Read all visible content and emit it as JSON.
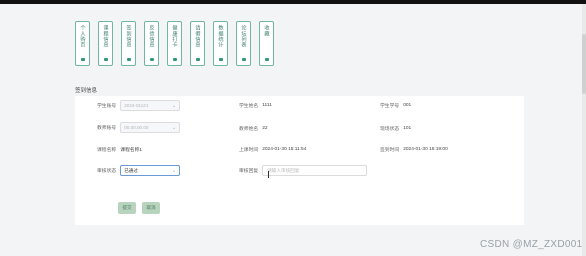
{
  "nav": [
    {
      "label": "个人购页"
    },
    {
      "label": "课程信息"
    },
    {
      "label": "签到信息"
    },
    {
      "label": "反债信息"
    },
    {
      "label": "健康打卡"
    },
    {
      "label": "请假信息"
    },
    {
      "label": "数据统计"
    },
    {
      "label": "论坛列表"
    },
    {
      "label": "收藏"
    }
  ],
  "section_title": "签到信息",
  "form": {
    "student_id_label": "学生账号",
    "student_id_value": "2024-01121",
    "student_name_label": "学生姓名",
    "student_name_value": "1111",
    "student_no_label": "学生学号",
    "student_no_value": "001",
    "teacher_id_label": "教师账号",
    "teacher_id_value": "00.00.00.00",
    "teacher_name_label": "教师姓名",
    "teacher_name_value": "22",
    "status_label": "现场状态",
    "status_value": "101",
    "course_label": "课程名称",
    "course_value": "课程名称1",
    "class_time_label": "上课时间",
    "class_time_value": "2024-01-30 15:11:54",
    "checkin_time_label": "签到时间",
    "checkin_time_value": "2024-01-30 16:19:00",
    "audit_status_label": "审核状态",
    "audit_status_value": "已通过",
    "audit_reply_label": "审核回复",
    "audit_reply_placeholder": "请输入审核回复"
  },
  "buttons": {
    "submit": "提交",
    "cancel": "取消"
  },
  "watermark": "CSDN @MZ_ZXD001"
}
